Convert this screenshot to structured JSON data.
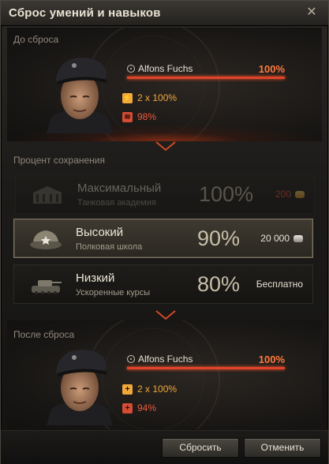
{
  "window": {
    "title": "Сброс умений и навыков",
    "close_glyph": "✕"
  },
  "before": {
    "label": "До сброса",
    "crew_name": "Alfons Fuchs",
    "percent": "100%",
    "percent_value": 100,
    "skills": [
      {
        "icon": "skill-orange-icon",
        "text": "2 x 100%"
      },
      {
        "icon": "skill-red-icon",
        "text": "98%"
      }
    ]
  },
  "retention": {
    "label": "Процент сохранения",
    "options": [
      {
        "title": "Максимальный",
        "subtitle": "Танковая академия",
        "percent": "100%",
        "cost": "200",
        "currency": "gold",
        "state": "disabled"
      },
      {
        "title": "Высокий",
        "subtitle": "Полковая школа",
        "percent": "90%",
        "cost": "20 000",
        "currency": "silver",
        "state": "selected"
      },
      {
        "title": "Низкий",
        "subtitle": "Ускоренные курсы",
        "percent": "80%",
        "cost": "Бесплатно",
        "currency": "",
        "state": "normal"
      }
    ]
  },
  "after": {
    "label": "После сброса",
    "crew_name": "Alfons Fuchs",
    "percent": "100%",
    "percent_value": 100,
    "skills": [
      {
        "icon": "plus-orange-icon",
        "text": "2 x 100%"
      },
      {
        "icon": "plus-red-icon",
        "text": "94%"
      }
    ]
  },
  "buttons": {
    "reset": "Сбросить",
    "cancel": "Отменить"
  },
  "colors": {
    "accent_orange": "#ff7a3d",
    "bar_red": "#e0432a",
    "gold": "#f0a83a",
    "skill_red": "#ef5a3a"
  }
}
